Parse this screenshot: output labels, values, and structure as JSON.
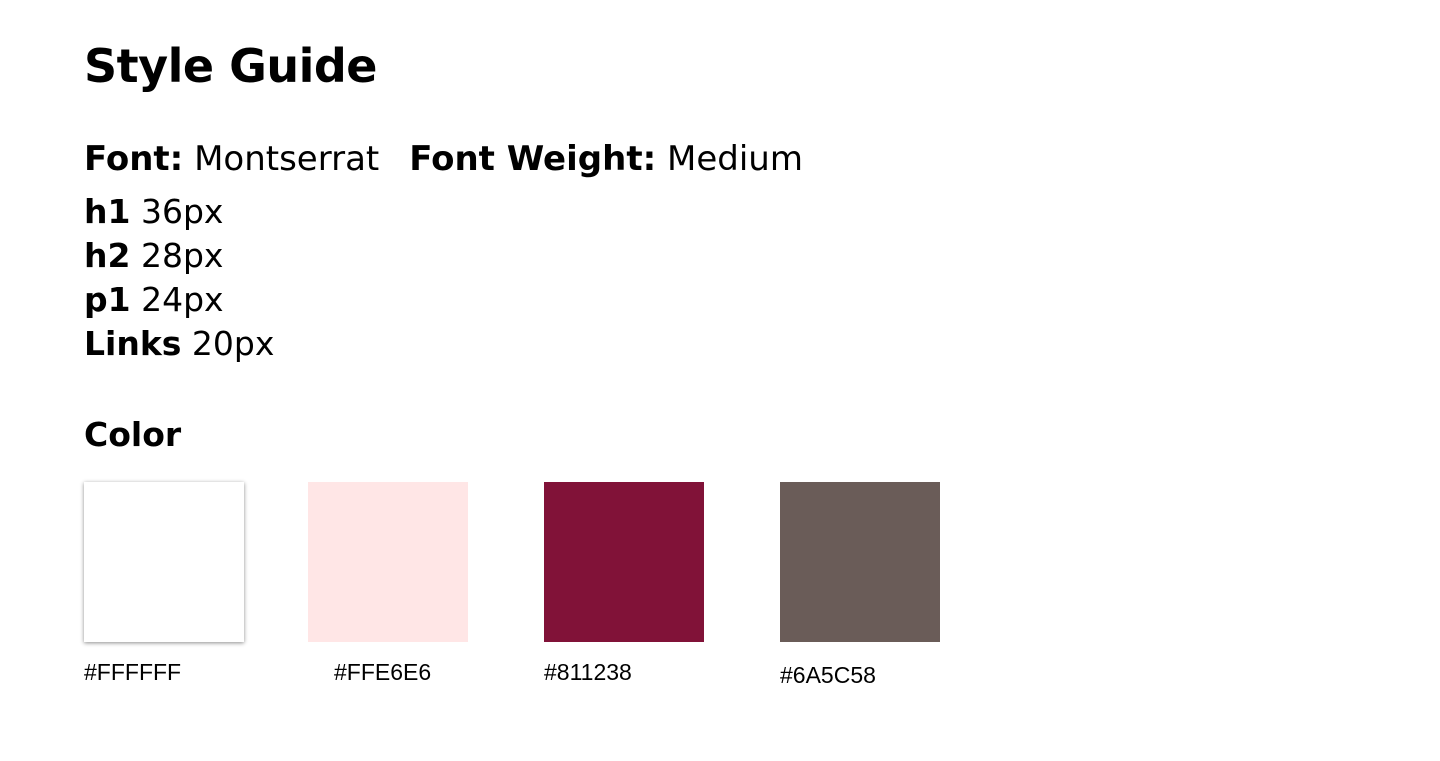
{
  "header": {
    "title": "Style Guide"
  },
  "typography": {
    "font_label": "Font:",
    "font_value": "Montserrat",
    "weight_label": "Font Weight:",
    "weight_value": "Medium",
    "sizes": [
      {
        "label": "h1",
        "value": "36px"
      },
      {
        "label": "h2",
        "value": "28px"
      },
      {
        "label": "p1",
        "value": "24px"
      },
      {
        "label": "Links",
        "value": "20px"
      }
    ]
  },
  "colors": {
    "heading": "Color",
    "swatches": [
      {
        "hex": "#FFFFFF",
        "color": "#FFFFFF"
      },
      {
        "hex": "#FFE6E6",
        "color": "#FFE6E6"
      },
      {
        "hex": "#811238",
        "color": "#811238"
      },
      {
        "hex": "#6A5C58",
        "color": "#6A5C58"
      }
    ]
  }
}
